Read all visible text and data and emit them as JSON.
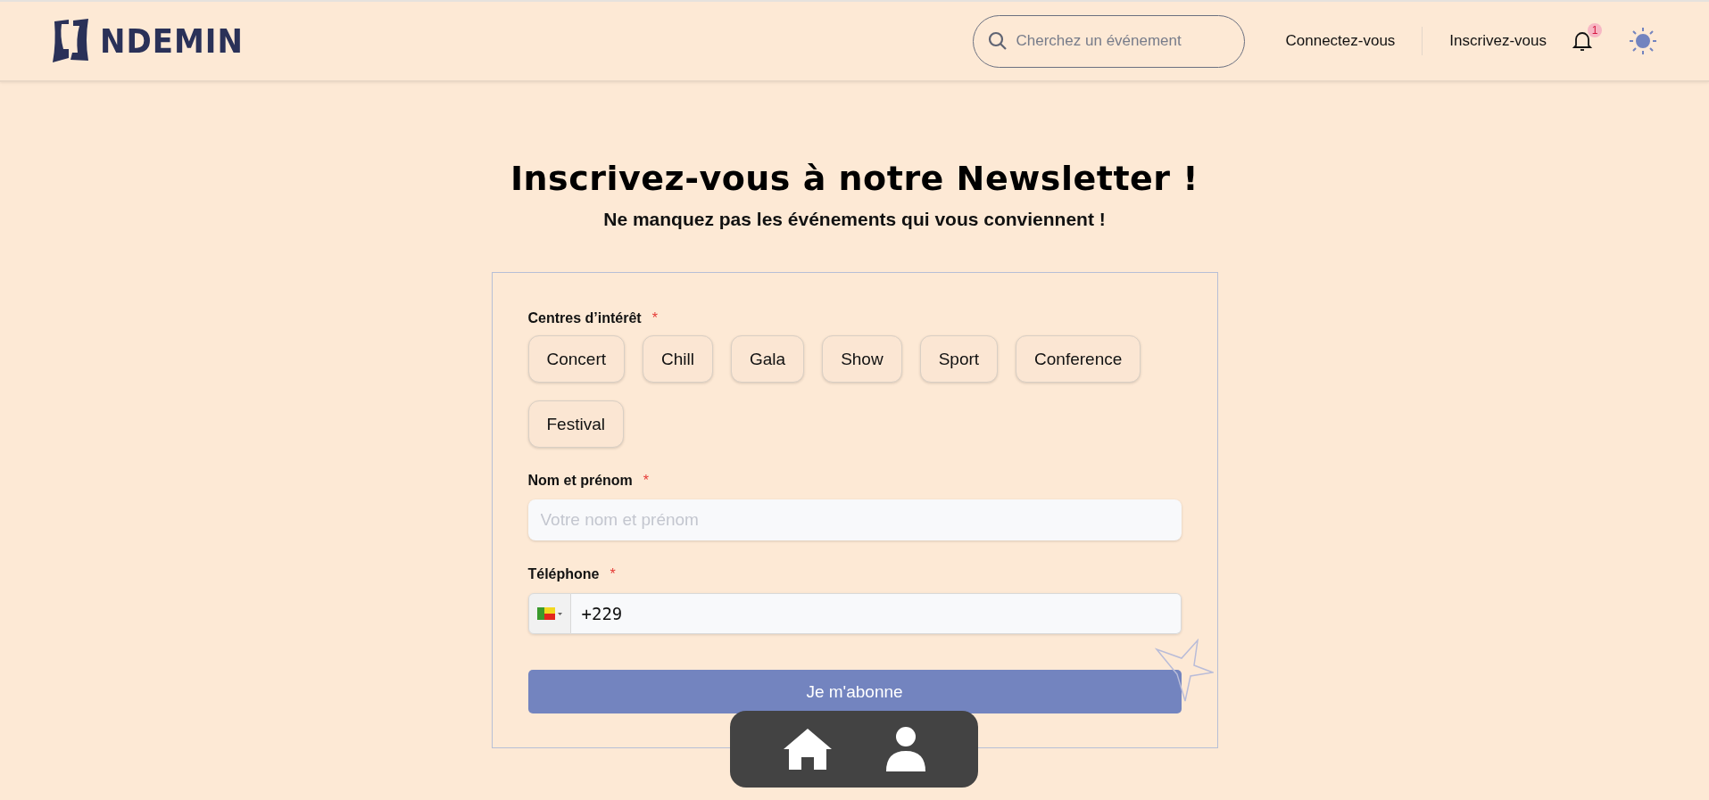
{
  "header": {
    "logo": "NDEMIN",
    "search": {
      "placeholder": "Cherchez un événement"
    },
    "links": [
      "Connectez-vous",
      "Inscrivez-vous"
    ],
    "notifications": {
      "count": "1"
    }
  },
  "title": "Inscrivez-vous à notre Newsletter !",
  "subtitle": "Ne manquez pas les événements qui vous conviennent !",
  "form": {
    "interests": {
      "label": "Centres d’intérêt",
      "required": "*",
      "options": [
        {
          "label": "Concert",
          "selected": false
        },
        {
          "label": "Chill",
          "selected": false
        },
        {
          "label": "Gala",
          "selected": false
        },
        {
          "label": "Show",
          "selected": false
        },
        {
          "label": "Sport",
          "selected": false
        },
        {
          "label": "Conference",
          "selected": false
        },
        {
          "label": "Festival",
          "selected": false
        }
      ]
    },
    "name": {
      "label": "Nom et prénom",
      "required": "*",
      "placeholder": "Votre nom et prénom"
    },
    "phone": {
      "label": "Téléphone",
      "required": "*",
      "value": "+229"
    },
    "submit": "Je m'abonne"
  }
}
